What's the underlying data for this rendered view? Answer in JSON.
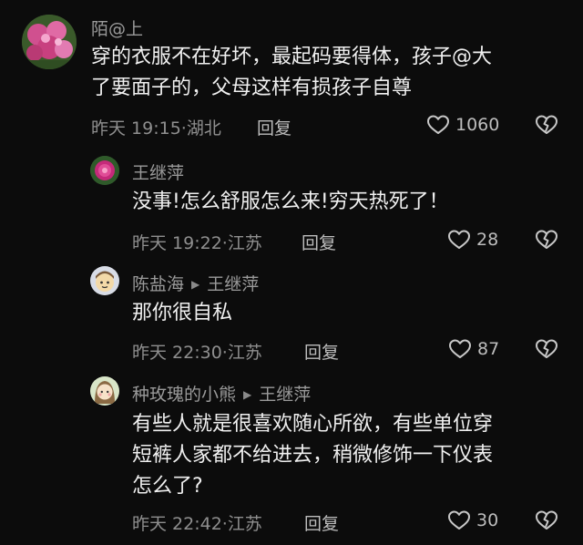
{
  "comments": [
    {
      "name": "陌@上",
      "lines": [
        "穿的衣服不在好坏，最起码要得体，孩子@大",
        "了要面子的，父母这样有损孩子自尊"
      ],
      "time": "昨天 19:15",
      "location": "湖北",
      "reply_label": "回复",
      "likes": "1060"
    },
    {
      "name": "王继萍",
      "lines": [
        "没事!怎么舒服怎么来!穷天热死了！"
      ],
      "time": "昨天 19:22",
      "location": "江苏",
      "reply_label": "回复",
      "likes": "28"
    },
    {
      "name": "陈盐海",
      "reply_to": "王继萍",
      "lines": [
        "那你很自私"
      ],
      "time": "昨天 22:30",
      "location": "江苏",
      "reply_label": "回复",
      "likes": "87"
    },
    {
      "name": "种玫瑰的小熊",
      "reply_to": "王继萍",
      "lines": [
        "有些人就是很喜欢随心所欲，有些单位穿",
        "短裤人家都不给进去，稍微修饰一下仪表",
        "怎么了?"
      ],
      "time": "昨天 22:42",
      "location": "江苏",
      "reply_label": "回复",
      "likes": "30"
    }
  ],
  "meta_separator": "·",
  "icons": {
    "like": "heart-outline-icon",
    "dislike": "broken-heart-icon",
    "reply_arrow": "triangle-right-icon"
  },
  "colors": {
    "background": "#0c0c0c",
    "text": "#f0f0f0",
    "muted": "#8f8f8f"
  }
}
